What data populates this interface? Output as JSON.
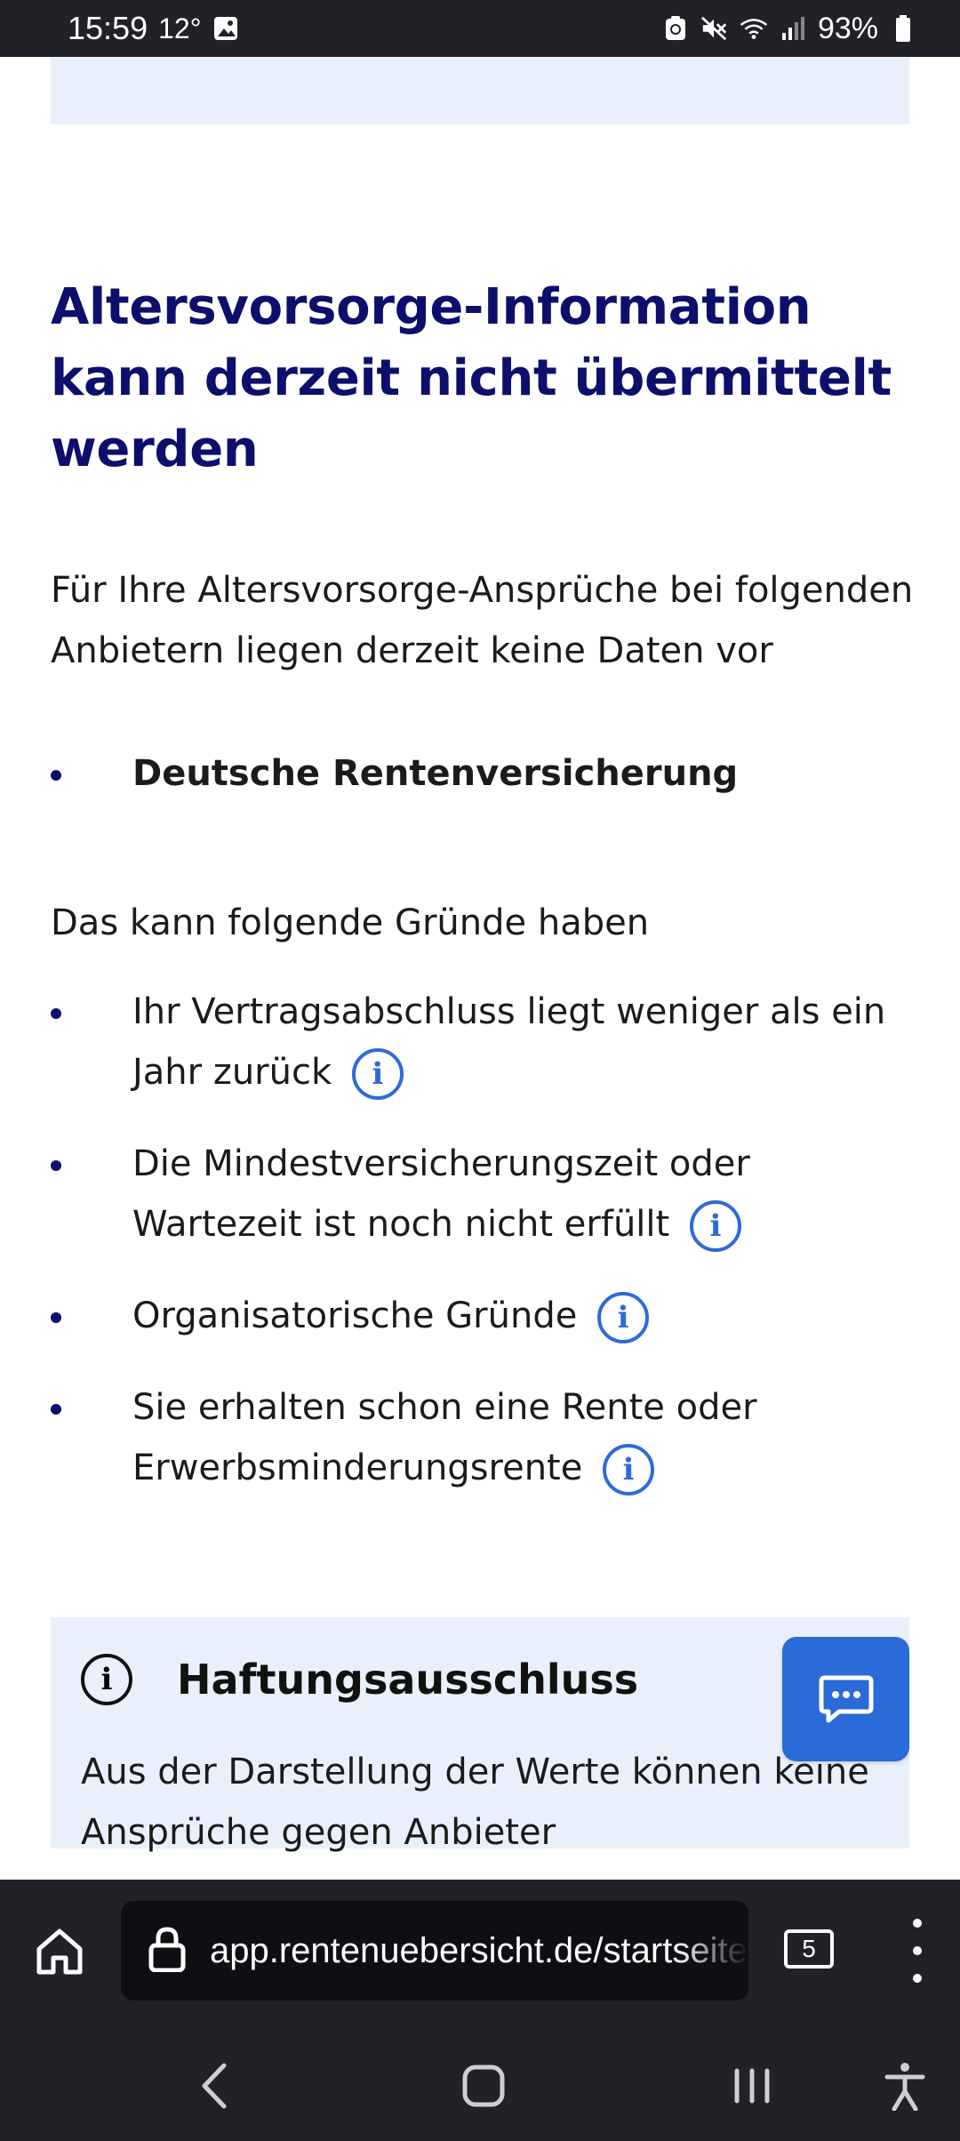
{
  "status_bar": {
    "time": "15:59",
    "temperature": "12°",
    "battery": "93%",
    "icons": [
      "image-icon",
      "data-saver-icon",
      "mute-icon",
      "wifi-icon",
      "signal-icon",
      "battery-icon"
    ]
  },
  "main": {
    "title": "Altersvorsorge-Information kann derzeit nicht übermittelt werden",
    "intro": "Für Ihre Altersvorsorge-Ansprüche bei folgenden Anbietern liegen derzeit keine Daten vor",
    "providers": [
      "Deutsche Rentenversicherung"
    ],
    "reasons_intro": "Das kann folgende Gründe haben",
    "reasons": [
      "Ihr Vertragsabschluss liegt weniger als ein Jahr zurück",
      "Die Mindestversicherungszeit oder Wartezeit ist noch nicht erfüllt",
      "Organisatorische Gründe",
      "Sie erhalten schon eine Rente oder Erwerbsminderungsrente"
    ],
    "info_icon_glyph": "i"
  },
  "disclaimer": {
    "title": "Haftungsausschluss",
    "text": "Aus der Darstellung der Werte können keine",
    "text_cut": "Ansprüche gegen Anbieter",
    "icon_glyph": "i"
  },
  "browser": {
    "url": "app.rentenuebersicht.de/startseite",
    "tab_count": "5"
  },
  "colors": {
    "title": "#0c0f6b",
    "accent": "#2f6ad9",
    "panel_bg": "#eaf0fb",
    "chat_button": "#2a6ad9",
    "bars": "#212128"
  }
}
